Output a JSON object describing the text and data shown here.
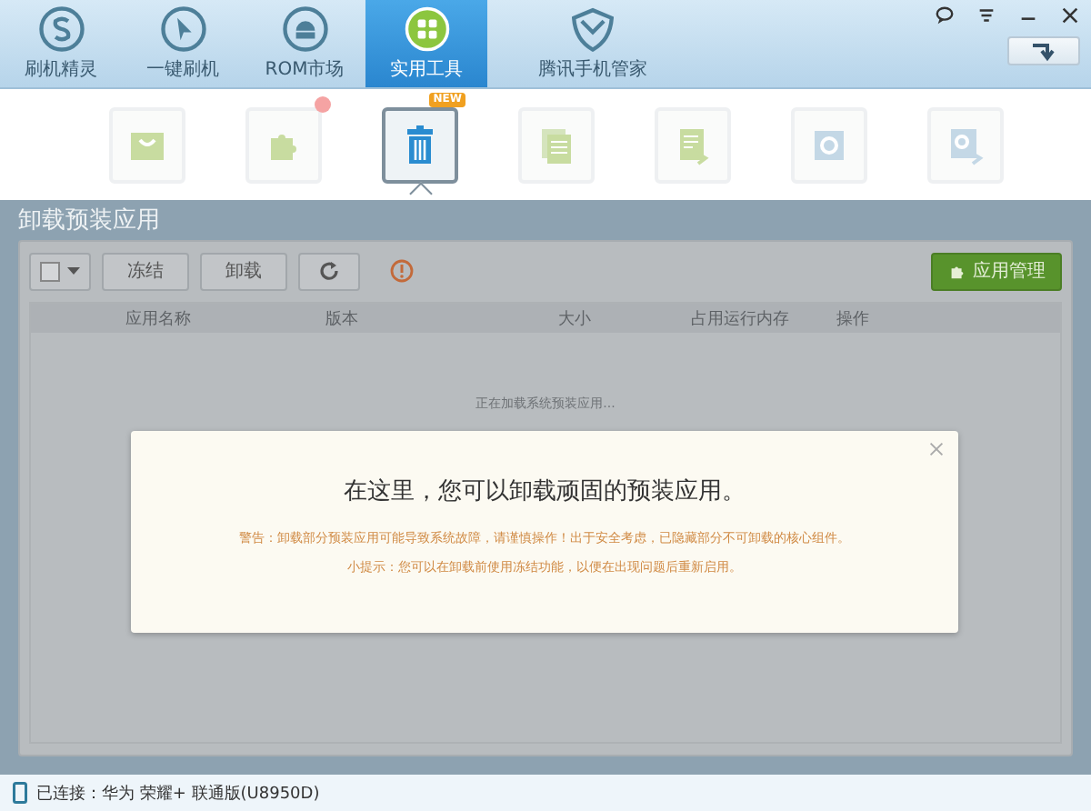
{
  "nav_tabs": [
    {
      "label": "刷机精灵",
      "selected": false
    },
    {
      "label": "一键刷机",
      "selected": false
    },
    {
      "label": "ROM市场",
      "selected": false
    },
    {
      "label": "实用工具",
      "selected": true
    },
    {
      "label": "腾讯手机管家",
      "selected": false
    }
  ],
  "tools": [
    {
      "selected": false,
      "dot": false
    },
    {
      "selected": false,
      "dot": true
    },
    {
      "selected": true,
      "dot": false,
      "badge": "NEW"
    },
    {
      "selected": false,
      "dot": false
    },
    {
      "selected": false,
      "dot": false
    },
    {
      "selected": false,
      "dot": false
    },
    {
      "selected": false,
      "dot": false
    }
  ],
  "panel": {
    "title": "卸载预装应用",
    "buttons": [
      "冻结",
      "卸载"
    ],
    "manage_button": "应用管理",
    "columns": [
      "应用名称",
      "版本",
      "大小",
      "占用运行内存",
      "操作"
    ],
    "loading": "正在加载系统预装应用..."
  },
  "dialog": {
    "heading": "在这里，您可以卸载顽固的预装应用。",
    "warning": "警告：卸载部分预装应用可能导致系统故障，请谨慎操作！出于安全考虑，已隐藏部分不可卸载的核心组件。",
    "tip": "小提示：您可以在卸载前使用冻结功能，以便在出现问题后重新启用。"
  },
  "status_bar": "已连接：华为 荣耀+ 联通版(U8950D)"
}
